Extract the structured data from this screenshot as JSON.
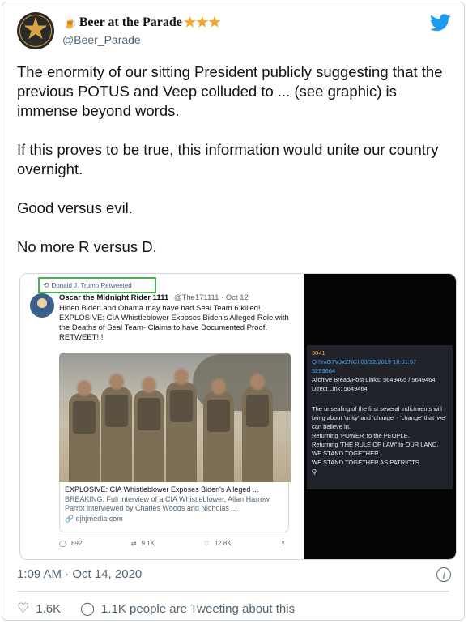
{
  "tweet": {
    "display_name": "Beer at the Parade",
    "name_stars": "★★★",
    "handle": "@Beer_Parade",
    "paragraphs": [
      "The enormity of our sitting President publicly suggesting that the previous POTUS and Veep colluded to ... (see graphic) is immense beyond words.",
      "If this proves to be true, this information would unite our country overnight.",
      "Good versus evil.",
      "No more R versus D."
    ],
    "timestamp": "1:09 AM · Oct 14, 2020",
    "likes": "1.6K",
    "talking": "1.1K people are Tweeting about this"
  },
  "embedded": {
    "retweeted_by": "Donald J. Trump Retweeted",
    "author": "Oscar the Midnight Rider 1111",
    "author_handle": "@The171111 · Oct 12",
    "text_line1": "Hiden Biden and Obama may have had Seal Team 6 killed!",
    "text_line2": "EXPLOSIVE: CIA Whistleblower Exposes Biden's Alleged Role with the Deaths of Seal Team- Claims to have Documented Proof. RETWEET!!!",
    "link_title": "EXPLOSIVE: CIA Whistleblower Exposes Biden's Alleged ...",
    "link_desc": "BREAKING: Full interview of a CIA Whistleblower, Allan Harrow Parrot interviewed by Charles Woods and Nicholas ...",
    "link_domain": "djhjmedia.com",
    "replies": "892",
    "retweets": "9.1K",
    "likes": "12.8K"
  },
  "qpost": {
    "number": "3041",
    "header": "Q !!mG7VJxZNCI 03/12/2019 18:01:57",
    "id": "5293664",
    "archive": "Archive Bread/Post Links: 5649465 / 5649464",
    "direct": "Direct Link: 5649464",
    "body": [
      "The unsealing of the first several indictments will bring about 'unity' and 'change' - 'change' that 'we' can believe in.",
      "Returning 'POWER' to the PEOPLE.",
      "Returning 'THE RULE OF LAW' to OUR LAND.",
      "WE STAND TOGETHER.",
      "WE STAND TOGETHER AS PATRIOTS.",
      "Q"
    ]
  },
  "colors": {
    "twitter_blue": "#1d9bf0",
    "highlight_green": "#4cae4f",
    "text_gray": "#536471"
  },
  "icons": [
    "twitter-bird-icon",
    "info-icon",
    "heart-icon",
    "comment-bubble-icon",
    "retweet-icon",
    "share-icon"
  ]
}
